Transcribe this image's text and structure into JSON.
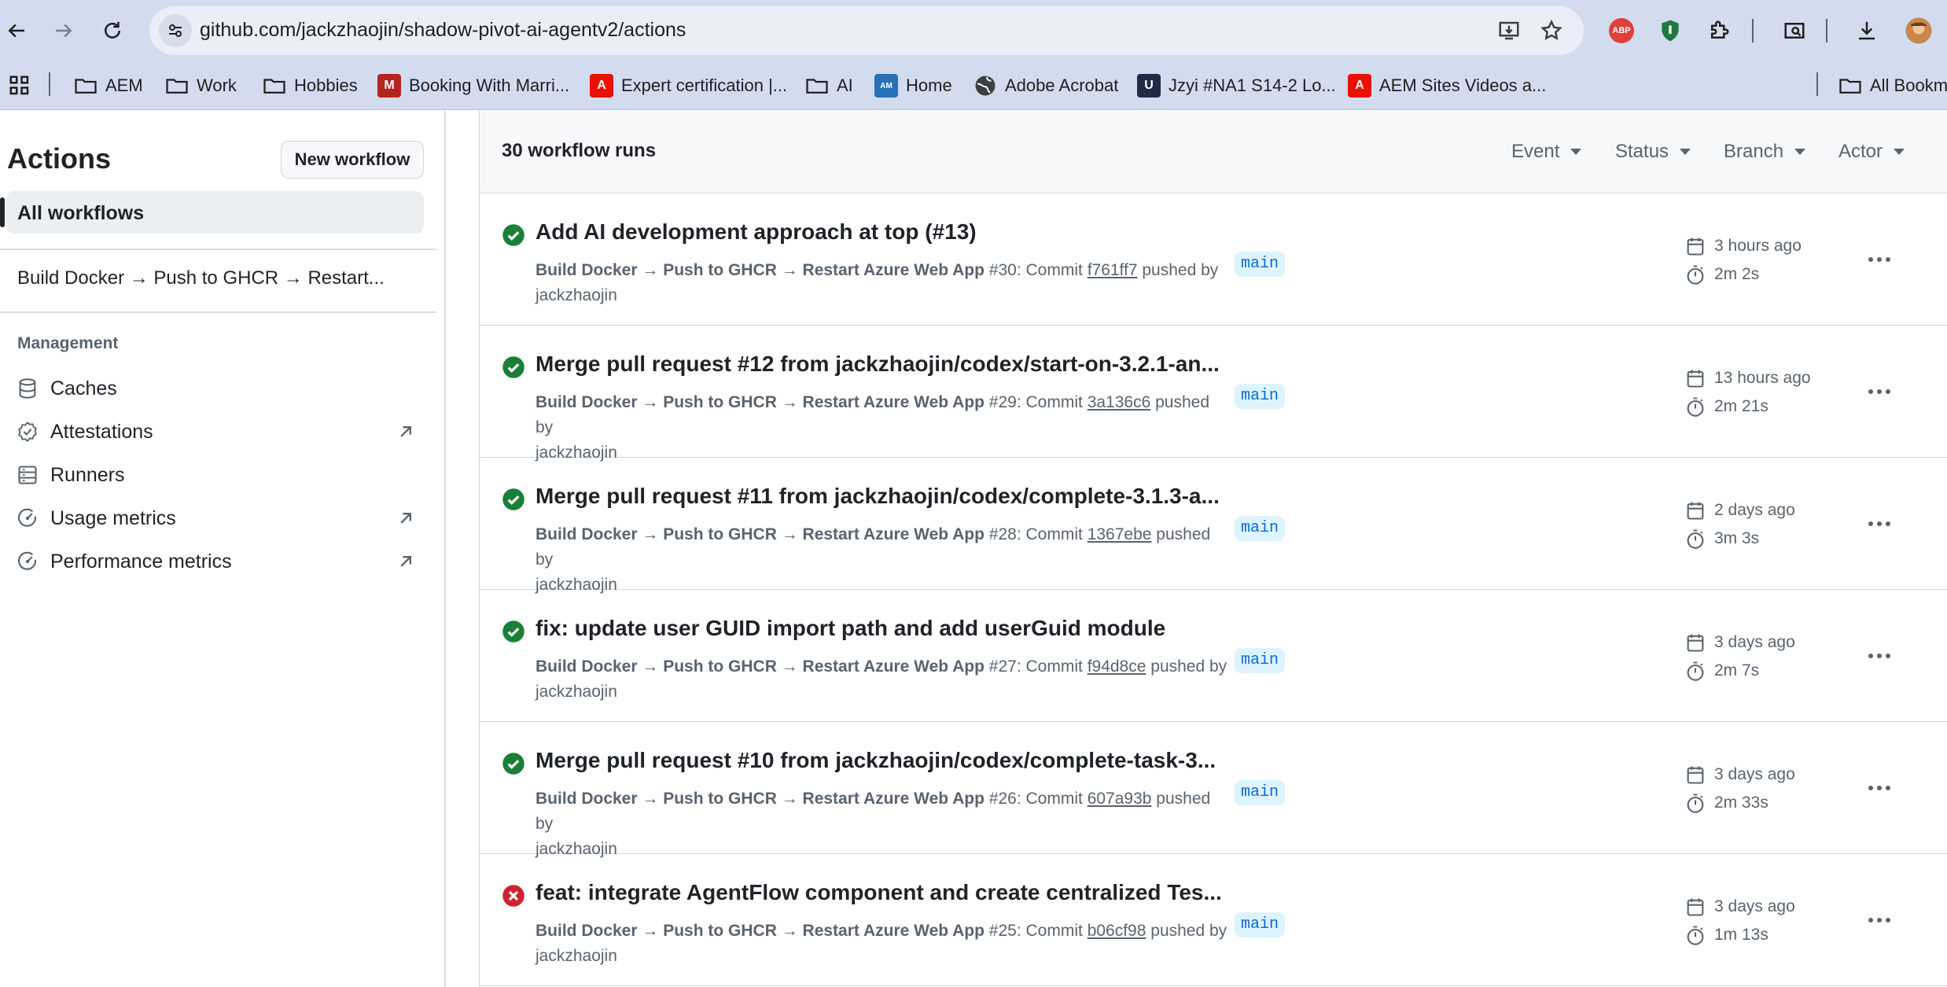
{
  "browser": {
    "url": "github.com/jackzhaojin/shadow-pivot-ai-agentv2/actions",
    "extensions": [
      "abp-icon",
      "shield-extension-icon",
      "puzzle-icon",
      "search-panel-icon",
      "download-icon",
      "profile-avatar"
    ],
    "abp_label": "ABP"
  },
  "bookmarks": {
    "items": [
      {
        "label": "AEM",
        "icon": "folder-icon"
      },
      {
        "label": "Work",
        "icon": "folder-icon"
      },
      {
        "label": "Hobbies",
        "icon": "folder-icon"
      },
      {
        "label": "Booking With Marri...",
        "icon": "marriott-icon"
      },
      {
        "label": "Expert certification |...",
        "icon": "adobe-icon"
      },
      {
        "label": "AI",
        "icon": "folder-icon"
      },
      {
        "label": "Home",
        "icon": "amex-icon"
      },
      {
        "label": "Adobe Acrobat",
        "icon": "globe-icon"
      },
      {
        "label": "Jzyi #NA1 S14-2 Lo...",
        "icon": "u-icon"
      },
      {
        "label": "AEM Sites Videos a...",
        "icon": "adobe-icon"
      }
    ],
    "all_bookmarks": "All Bookm"
  },
  "sidebar": {
    "title": "Actions",
    "new_workflow": "New workflow",
    "all_workflows": "All workflows",
    "workflow": "Build Docker → Push to GHCR → Restart...",
    "management_heading": "Management",
    "items": [
      {
        "label": "Caches",
        "icon": "database-icon",
        "external": false
      },
      {
        "label": "Attestations",
        "icon": "verified-icon",
        "external": true
      },
      {
        "label": "Runners",
        "icon": "server-icon",
        "external": false
      },
      {
        "label": "Usage metrics",
        "icon": "meter-icon",
        "external": true
      },
      {
        "label": "Performance metrics",
        "icon": "meter-icon",
        "external": true
      }
    ]
  },
  "main": {
    "run_count": "30 workflow runs",
    "filters": [
      "Event",
      "Status",
      "Branch",
      "Actor"
    ],
    "runs": [
      {
        "status": "success",
        "title": "Add AI development approach at top (#13)",
        "workflow": "Build Docker → Push to GHCR → Restart Azure Web App",
        "run": "#30: Commit",
        "sha": "f761ff7",
        "pushed": "pushed by",
        "actor": "jackzhaojin",
        "branch": "main",
        "when": "3 hours ago",
        "duration": "2m 2s"
      },
      {
        "status": "success",
        "title": "Merge pull request #12 from jackzhaojin/codex/start-on-3.2.1-an...",
        "workflow": "Build Docker → Push to GHCR → Restart Azure Web App",
        "run": "#29: Commit",
        "sha": "3a136c6",
        "pushed": "pushed by",
        "actor": "jackzhaojin",
        "branch": "main",
        "when": "13 hours ago",
        "duration": "2m 21s"
      },
      {
        "status": "success",
        "title": "Merge pull request #11 from jackzhaojin/codex/complete-3.1.3-a...",
        "workflow": "Build Docker → Push to GHCR → Restart Azure Web App",
        "run": "#28: Commit",
        "sha": "1367ebe",
        "pushed": "pushed by",
        "actor": "jackzhaojin",
        "branch": "main",
        "when": "2 days ago",
        "duration": "3m 3s"
      },
      {
        "status": "success",
        "title": "fix: update user GUID import path and add userGuid module",
        "workflow": "Build Docker → Push to GHCR → Restart Azure Web App",
        "run": "#27: Commit",
        "sha": "f94d8ce",
        "pushed": "pushed by",
        "actor": "jackzhaojin",
        "branch": "main",
        "when": "3 days ago",
        "duration": "2m 7s"
      },
      {
        "status": "success",
        "title": "Merge pull request #10 from jackzhaojin/codex/complete-task-3...",
        "workflow": "Build Docker → Push to GHCR → Restart Azure Web App",
        "run": "#26: Commit",
        "sha": "607a93b",
        "pushed": "pushed by",
        "actor": "jackzhaojin",
        "branch": "main",
        "when": "3 days ago",
        "duration": "2m 33s"
      },
      {
        "status": "failure",
        "title": "feat: integrate AgentFlow component and create centralized Tes...",
        "workflow": "Build Docker → Push to GHCR → Restart Azure Web App",
        "run": "#25: Commit",
        "sha": "b06cf98",
        "pushed": "pushed by",
        "actor": "jackzhaojin",
        "branch": "main",
        "when": "3 days ago",
        "duration": "1m 13s"
      }
    ]
  },
  "colors": {
    "success": "#1a7f37",
    "failure": "#cf222e",
    "branch_bg": "#ddf4ff",
    "branch_fg": "#0969da",
    "chrome_bg": "#d3dbef"
  }
}
